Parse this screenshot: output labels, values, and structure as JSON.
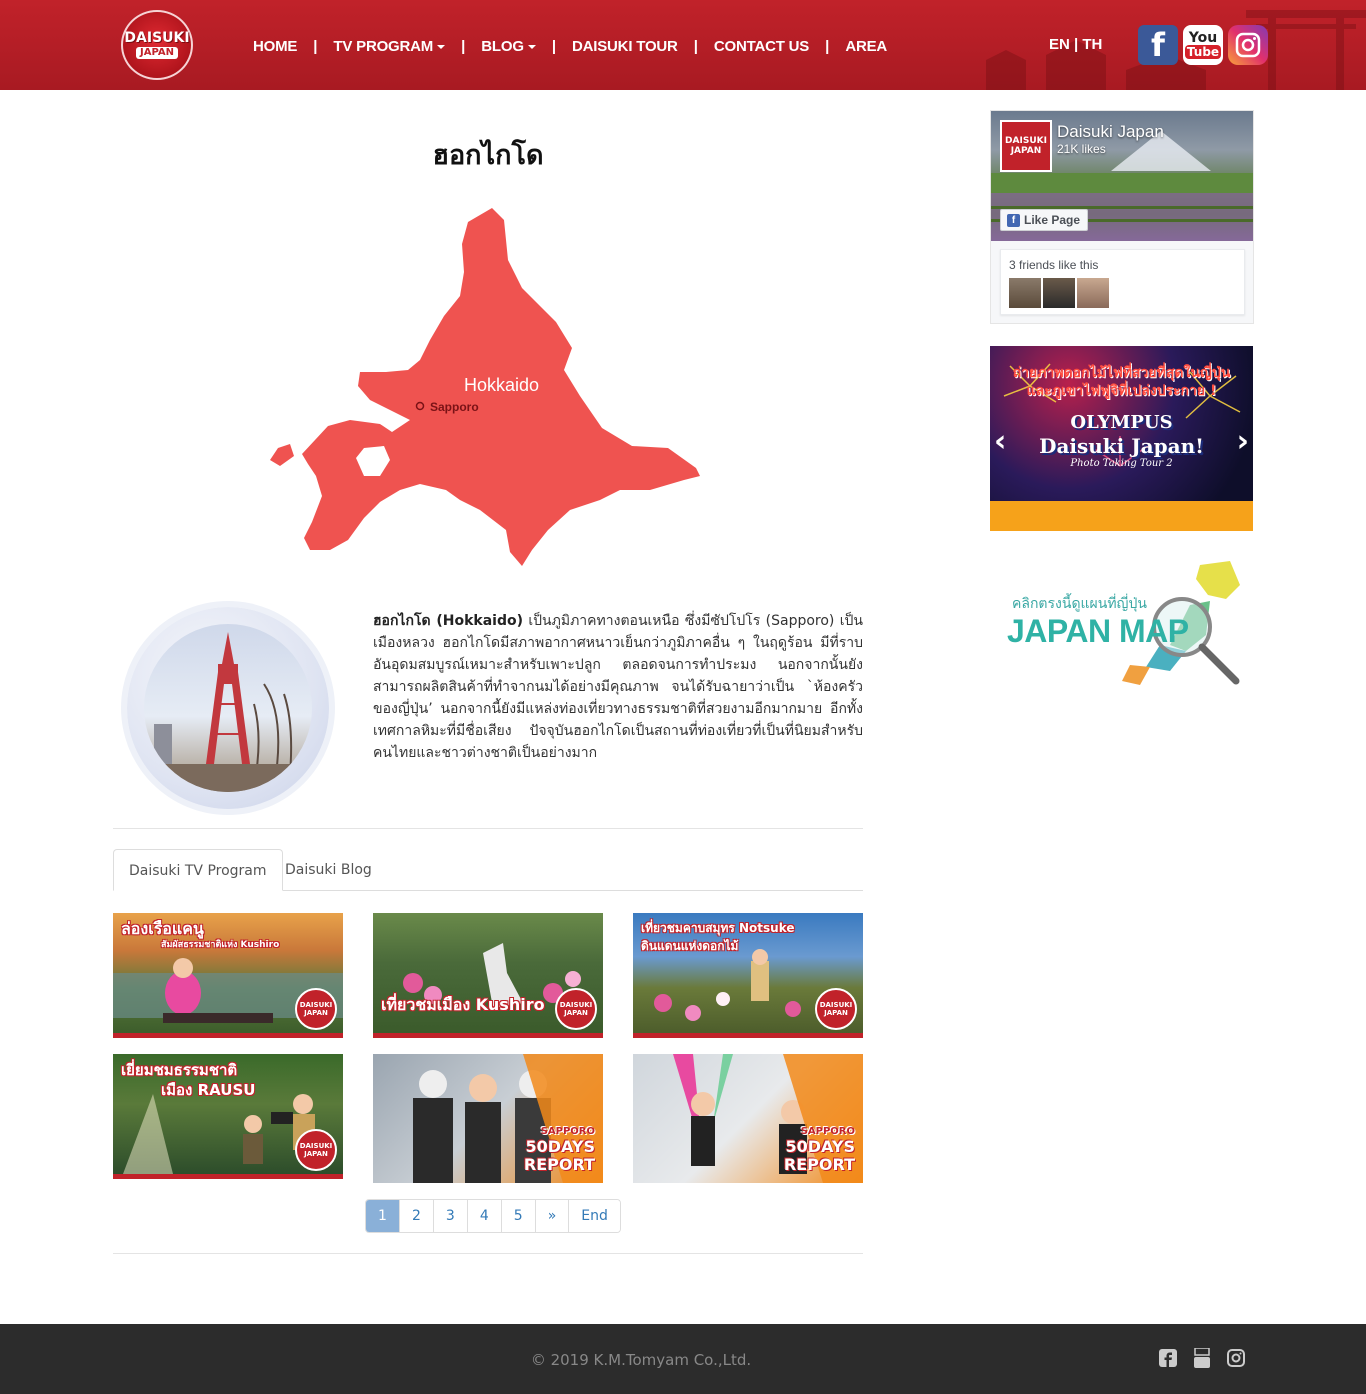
{
  "header": {
    "logo": {
      "line1": "DAISUKI",
      "line2": "JAPAN"
    },
    "nav": [
      {
        "label": "HOME"
      },
      {
        "label": "TV PROGRAM"
      },
      {
        "label": "BLOG"
      },
      {
        "label": "DAISUKI TOUR"
      },
      {
        "label": "CONTACT US"
      },
      {
        "label": "AREA"
      }
    ],
    "lang": {
      "en": "EN",
      "sep": " | ",
      "th": "TH"
    },
    "social": {
      "facebook": "f",
      "youtube_top": "You",
      "youtube_bottom": "Tube"
    }
  },
  "main": {
    "title": "ฮอกไกโด",
    "map": {
      "region_label": "Hokkaido",
      "city_label": "Sapporo",
      "fill_color": "#ef5350"
    },
    "description": {
      "bold": "ฮอกไกโด (Hokkaido)",
      "text": " เป็นภูมิภาคทางตอนเหนือ ซึ่งมีซัปโปโร (Sapporo) เป็นเมืองหลวง ฮอกไกโดมีสภาพอากาศหนาวเย็นกว่าภูมิภาคอื่น ๆ ในฤดูร้อน มีที่ราบอันอุดมสมบูรณ์เหมาะสำหรับเพาะปลูก ตลอดจนการทำประมง นอกจากนั้นยังสามารถผลิตสินค้าที่ทำจากนมได้อย่างมีคุณภาพ จนได้รับฉายาว่าเป็น `ห้องครัวของญี่ปุ่น’ นอกจากนี้ยังมีแหล่งท่องเที่ยวทางธรรมชาติที่สวยงามอีกมากมาย อีกทั้งเทศกาลหิมะที่มีชื่อเสียง ปัจจุบันฮอกไกโดเป็นสถานที่ท่องเที่ยวที่เป็นที่นิยมสำหรับคนไทยและชาวต่างชาติเป็นอย่างมาก"
    },
    "tabs": [
      {
        "label": "Daisuki TV Program"
      },
      {
        "label": "Daisuki Blog"
      }
    ],
    "thumbnails": [
      {
        "title": "ล่องเรือแคนู",
        "subtitle": "สัมผัสธรรมชาติแห่ง Kushiro",
        "badge": "DAISUKI JAPAN",
        "icon": "canoe-icon"
      },
      {
        "title": "เที่ยวชมเมือง Kushiro",
        "subtitle": "",
        "badge": "DAISUKI JAPAN",
        "icon": "crane-icon"
      },
      {
        "title": "เที่ยวชมคาบสมุทร Notsuke",
        "subtitle": "ดินแดนแห่งดอกไม้",
        "badge": "DAISUKI JAPAN",
        "icon": "flower-icon"
      },
      {
        "title": "เยี่ยมชมธรรมชาติ",
        "subtitle": "เมือง RAUSU",
        "badge": "DAISUKI JAPAN",
        "icon": "camera-icon"
      },
      {
        "title": "SAPPORO",
        "subtitle": "50DAYS REPORT",
        "badge": "",
        "icon": "ski-icon"
      },
      {
        "title": "SAPPORO",
        "subtitle": "50DAYS REPORT",
        "badge": "",
        "icon": "yoga-icon"
      }
    ],
    "pagination": [
      "1",
      "2",
      "3",
      "4",
      "5",
      "»",
      "End"
    ]
  },
  "sidebar": {
    "facebook": {
      "page_name": "Daisuki Japan",
      "likes": "21K likes",
      "like_button": "Like Page",
      "friends_text": "3 friends like this",
      "logo_text": "DAISUKI JAPAN"
    },
    "banner": {
      "headline": "ถ่ายภาพดอกไม้ไฟที่สวยที่สุดในญี่ปุ่น และภูเขาไฟฟูจิที่เปล่งประกาย !",
      "brand": "OLYMPUS",
      "title": "Daisuki Japan!",
      "sub": "Photo Taking Tour 2"
    },
    "japan_map": {
      "subtitle": "คลิกตรงนี้ดูแผนที่ญี่ปุ่น",
      "title": "JAPAN MAP"
    }
  },
  "footer": {
    "copyright": "© 2019 K.M.Tomyam Co.,Ltd."
  }
}
